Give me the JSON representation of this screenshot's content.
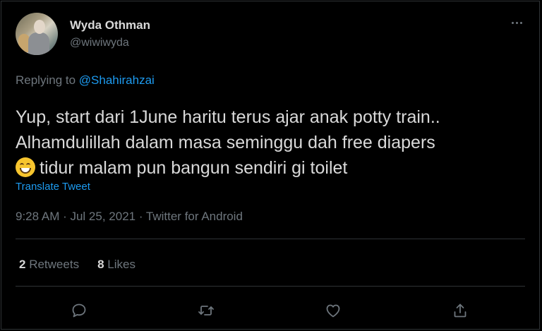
{
  "tweet": {
    "author_name": "Wyda Othman",
    "author_handle": "@wiwiwyda",
    "replying_prefix": "Replying to ",
    "replying_to": "@Shahirahzai",
    "text_line1": "Yup, start dari 1June haritu terus ajar anak potty train..",
    "text_line2": "Alhamdulillah dalam masa seminggu dah free diapers",
    "text_line3": "tidur malam pun bangun sendiri gi toilet",
    "emoji": "grinning-face-with-smiling-eyes",
    "translate_label": "Translate Tweet",
    "timestamp": "9:28 AM · Jul 25, 2021 · Twitter for Android"
  },
  "stats": {
    "retweets_count": "2",
    "retweets_label": "Retweets",
    "likes_count": "8",
    "likes_label": "Likes"
  },
  "actions": [
    "reply-icon",
    "retweet-icon",
    "like-icon",
    "share-icon"
  ],
  "colors": {
    "background": "#000000",
    "text": "#d9d9d9",
    "secondary": "#6e767d",
    "accent": "#1d9bf0",
    "border": "#2f3336"
  }
}
